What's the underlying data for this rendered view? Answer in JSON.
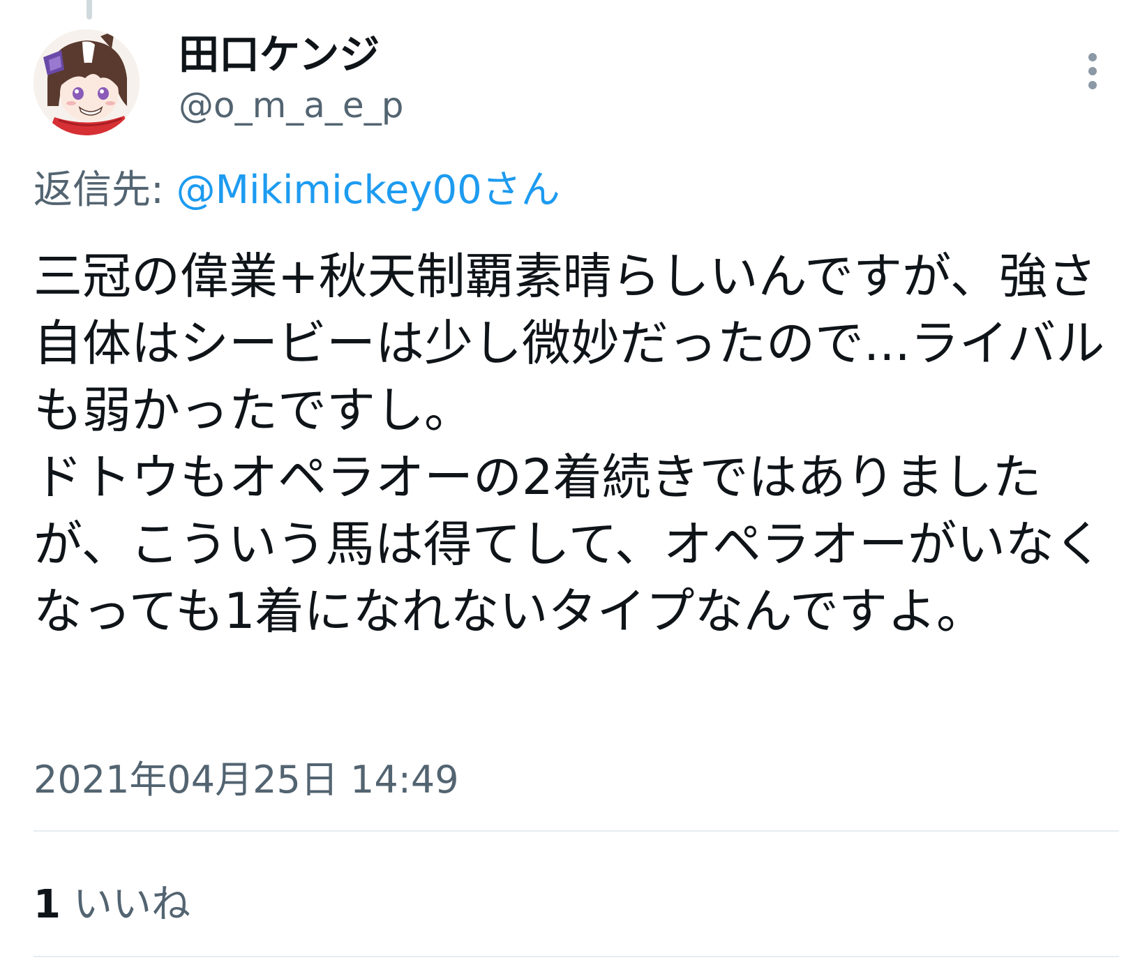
{
  "tweet": {
    "author": {
      "display_name": "田口ケンジ",
      "handle": "@o_m_a_e_p"
    },
    "reply_to": {
      "prefix": "返信先: ",
      "mention": "@Mikimickey00さん"
    },
    "text": "三冠の偉業+秋天制覇素晴らしいんですが、強さ自体はシービーは少し微妙だったので...ライバルも弱かったですし。\nドトウもオペラオーの2着続きではありましたが、こういう馬は得てして、オペラオーがいなくなっても1着になれないタイプなんですよ。",
    "timestamp": "2021年04月25日 14:49",
    "likes": {
      "count": "1",
      "label": "いいね"
    }
  },
  "icons": {
    "avatar": "profile-avatar",
    "more": "more-vertical-icon"
  },
  "colors": {
    "link": "#1d9bf0",
    "secondary_text": "#536471",
    "primary_text": "#0f1419",
    "divider": "#e6ecf0"
  }
}
